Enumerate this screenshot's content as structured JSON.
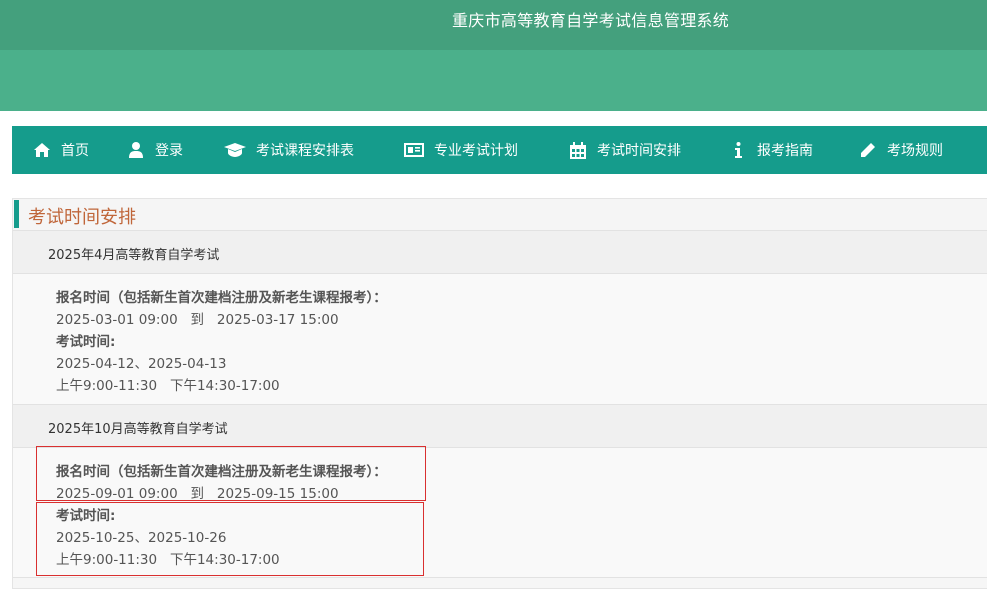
{
  "header": {
    "site_title": "重庆市高等教育自学考试信息管理系统"
  },
  "nav": {
    "items": [
      {
        "label": "首页",
        "icon": "home-icon"
      },
      {
        "label": "登录",
        "icon": "user-icon"
      },
      {
        "label": "考试课程安排表",
        "icon": "graduation-cap-icon"
      },
      {
        "label": "专业考试计划",
        "icon": "newspaper-icon"
      },
      {
        "label": "考试时间安排",
        "icon": "calendar-icon"
      },
      {
        "label": "报考指南",
        "icon": "info-icon"
      },
      {
        "label": "考场规则",
        "icon": "pencil-icon"
      }
    ],
    "color": "#159c8c"
  },
  "panel": {
    "title": "考试时间安排",
    "title_color": "#c0663a"
  },
  "exams": [
    {
      "title": "2025年4月高等教育自学考试",
      "registration_label": "报名时间（包括新生首次建档注册及新老生课程报考）：",
      "registration_time": "2025-03-01 09:00   到   2025-03-17 15:00",
      "exam_label": "考试时间:",
      "exam_dates": "2025-04-12、2025-04-13",
      "exam_sessions": "上午9:00-11:30   下午14:30-17:00"
    },
    {
      "title": "2025年10月高等教育自学考试",
      "registration_label": "报名时间（包括新生首次建档注册及新老生课程报考）：",
      "registration_time": "2025-09-01 09:00   到   2025-09-15 15:00",
      "exam_label": "考试时间:",
      "exam_dates": "2025-10-25、2025-10-26",
      "exam_sessions": "上午9:00-11:30   下午14:30-17:00"
    }
  ],
  "highlight_color": "#d93030"
}
